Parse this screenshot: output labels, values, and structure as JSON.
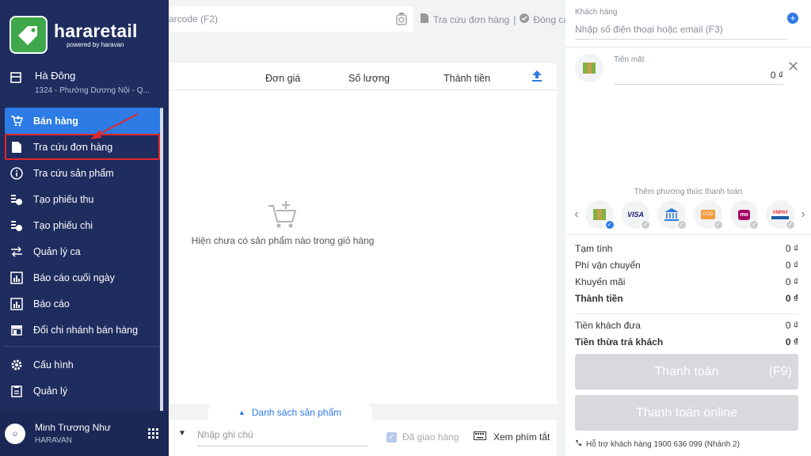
{
  "brand": {
    "name": "hararetail",
    "powered": "powered by haravan"
  },
  "store": {
    "name": "Hà Đông",
    "address": "1324 - Phường Dương Nội - Q..."
  },
  "menu": {
    "items": [
      {
        "label": "Bán hàng",
        "icon": "cart-icon"
      },
      {
        "label": "Tra cứu đơn hàng",
        "icon": "document-icon"
      },
      {
        "label": "Tra cứu sản phẩm",
        "icon": "info-icon"
      },
      {
        "label": "Tạo phiếu thu",
        "icon": "money-in-icon"
      },
      {
        "label": "Tạo phiếu chi",
        "icon": "money-out-icon"
      },
      {
        "label": "Quản lý ca",
        "icon": "swap-icon"
      },
      {
        "label": "Báo cáo cuối ngày",
        "icon": "report-icon"
      },
      {
        "label": "Báo cáo",
        "icon": "chart-icon"
      },
      {
        "label": "Đổi chi nhánh bán hàng",
        "icon": "store-icon"
      }
    ],
    "items2": [
      {
        "label": "Cấu hình",
        "icon": "gear-icon"
      },
      {
        "label": "Quản lý",
        "icon": "clipboard-icon"
      }
    ]
  },
  "user": {
    "name": "Minh Trương Như",
    "org": "HARAVAN"
  },
  "search": {
    "placeholder": "arcode (F2)"
  },
  "top_links": {
    "orders": "Tra cứu đơn hàng",
    "close_shift": "Đóng ca"
  },
  "cart": {
    "col_price": "Đơn giá",
    "col_qty": "Số lượng",
    "col_total": "Thành tiền",
    "empty": "Hiện chưa có sản phẩm nào trong giỏ hàng",
    "product_list": "Danh sách sản phẩm",
    "note_placeholder": "Nhập ghi chú",
    "delivered": "Đã giao hàng",
    "shortcuts": "Xem phím tắt"
  },
  "customer": {
    "label": "Khách hàng",
    "placeholder": "Nhập số điện thoại hoặc email (F3)"
  },
  "payment": {
    "cash_label": "Tiền mặt",
    "cash_value": "0 ₫",
    "add_method": "Thêm phương thức thanh toán",
    "methods": [
      "cash",
      "VISA",
      "bank",
      "COD",
      "momo",
      "VNPAY"
    ]
  },
  "summary": {
    "subtotal": {
      "label": "Tạm tính",
      "value": "0 ₫"
    },
    "shipping": {
      "label": "Phí vận chuyển",
      "value": "0 ₫"
    },
    "discount": {
      "label": "Khuyến mãi",
      "value": "0 ₫"
    },
    "total": {
      "label": "Thành tiền",
      "value": "0 ₫"
    },
    "paid": {
      "label": "Tiền khách đưa",
      "value": "0 ₫"
    },
    "change": {
      "label": "Tiền thừa trả khách",
      "value": "0 ₫"
    }
  },
  "buttons": {
    "pay": "Thanh toán",
    "pay_key": "(F9)",
    "pay_online": "Thanh toán online"
  },
  "support": "Hỗ trợ khách hàng 1900 636 099 (Nhánh 2)",
  "colors": {
    "sidebar": "#1e2c5e",
    "accent": "#2d7be5",
    "brand": "#3ea84a",
    "highlight": "#e0292b"
  }
}
